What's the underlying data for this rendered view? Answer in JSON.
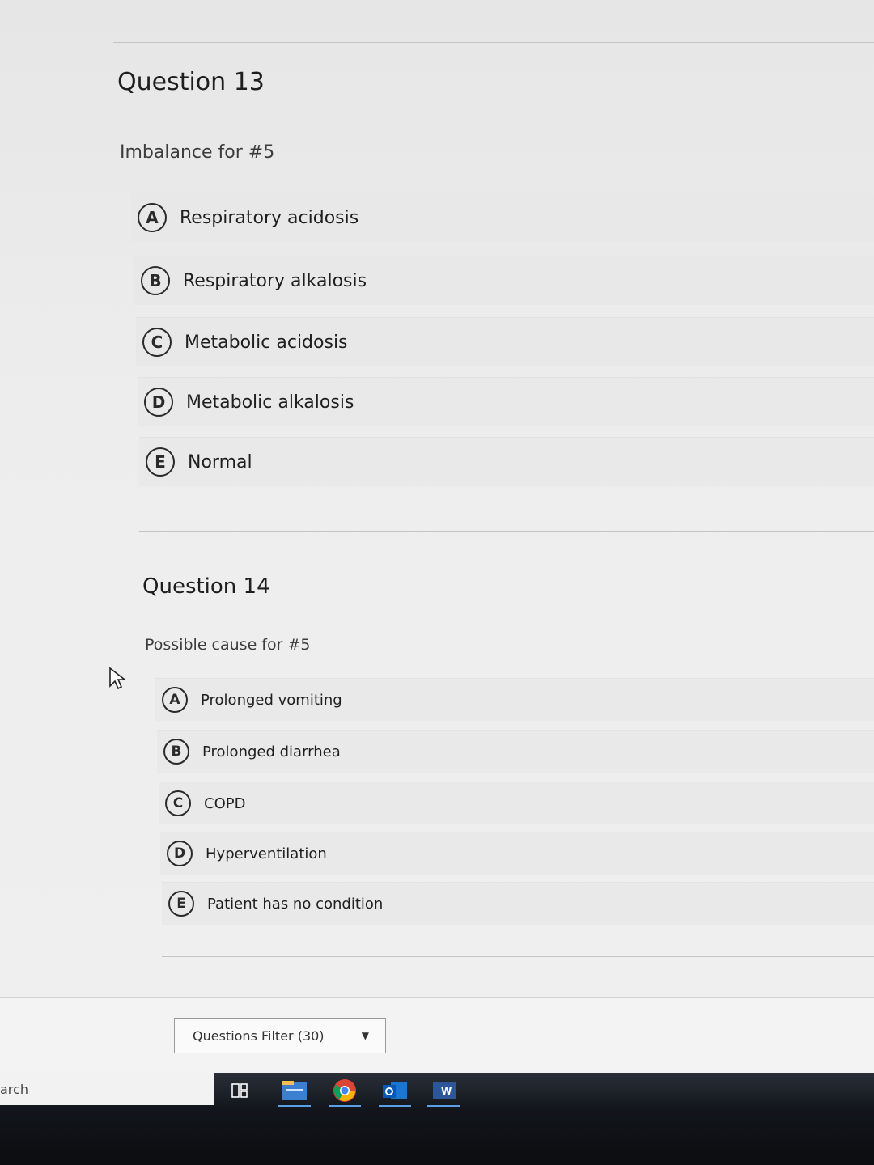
{
  "q13": {
    "title": "Question 13",
    "prompt": "Imbalance for #5",
    "options": [
      {
        "letter": "A",
        "label": "Respiratory acidosis"
      },
      {
        "letter": "B",
        "label": "Respiratory alkalosis"
      },
      {
        "letter": "C",
        "label": "Metabolic acidosis"
      },
      {
        "letter": "D",
        "label": "Metabolic alkalosis"
      },
      {
        "letter": "E",
        "label": "Normal"
      }
    ]
  },
  "q14": {
    "title": "Question 14",
    "prompt": "Possible cause for #5",
    "options": [
      {
        "letter": "A",
        "label": "Prolonged vomiting"
      },
      {
        "letter": "B",
        "label": "Prolonged diarrhea"
      },
      {
        "letter": "C",
        "label": "COPD"
      },
      {
        "letter": "D",
        "label": "Hyperventilation"
      },
      {
        "letter": "E",
        "label": "Patient has no condition"
      }
    ]
  },
  "footer": {
    "filter_label": "Questions Filter (30)"
  },
  "taskbar": {
    "search_text": "arch",
    "icons": [
      "task-view-icon",
      "file-explorer-icon",
      "chrome-icon",
      "outlook-icon",
      "word-icon"
    ]
  }
}
